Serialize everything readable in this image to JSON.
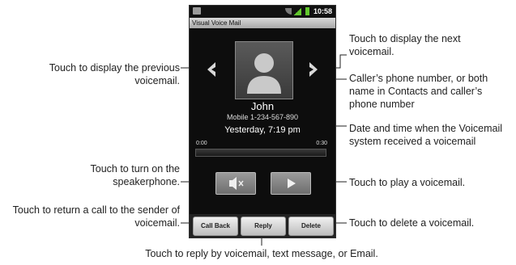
{
  "phone": {
    "status": {
      "time": "10:58"
    },
    "app_title": "Visual Voice Mail",
    "contact": {
      "name": "John",
      "phone": "Mobile 1-234-567-890"
    },
    "datetime": "Yesterday, 7:19 pm",
    "progress": {
      "start": "0:00",
      "end": "0:30",
      "fraction": 0.0
    },
    "buttons": {
      "call_back": "Call Back",
      "reply": "Reply",
      "delete": "Delete"
    },
    "icons": {
      "prev": "chevron-left-icon",
      "next": "chevron-right-icon",
      "speaker": "speaker-mute-icon",
      "play": "play-icon",
      "avatar": "person-icon"
    }
  },
  "annotations": {
    "prev": "Touch to display the previous voicemail.",
    "next": "Touch to display the next voicemail.",
    "caller": "Caller’s phone number, or both name in Contacts and caller’s phone number",
    "datetime": "Date and time when the Voicemail system received a voicemail",
    "speaker": "Touch to turn on the speakerphone.",
    "play": "Touch to play a voicemail.",
    "callback": "Touch to return a call to the sender of voicemail.",
    "delete": "Touch to delete a voicemail.",
    "reply": "Touch to reply by voicemail, text message, or Email."
  }
}
